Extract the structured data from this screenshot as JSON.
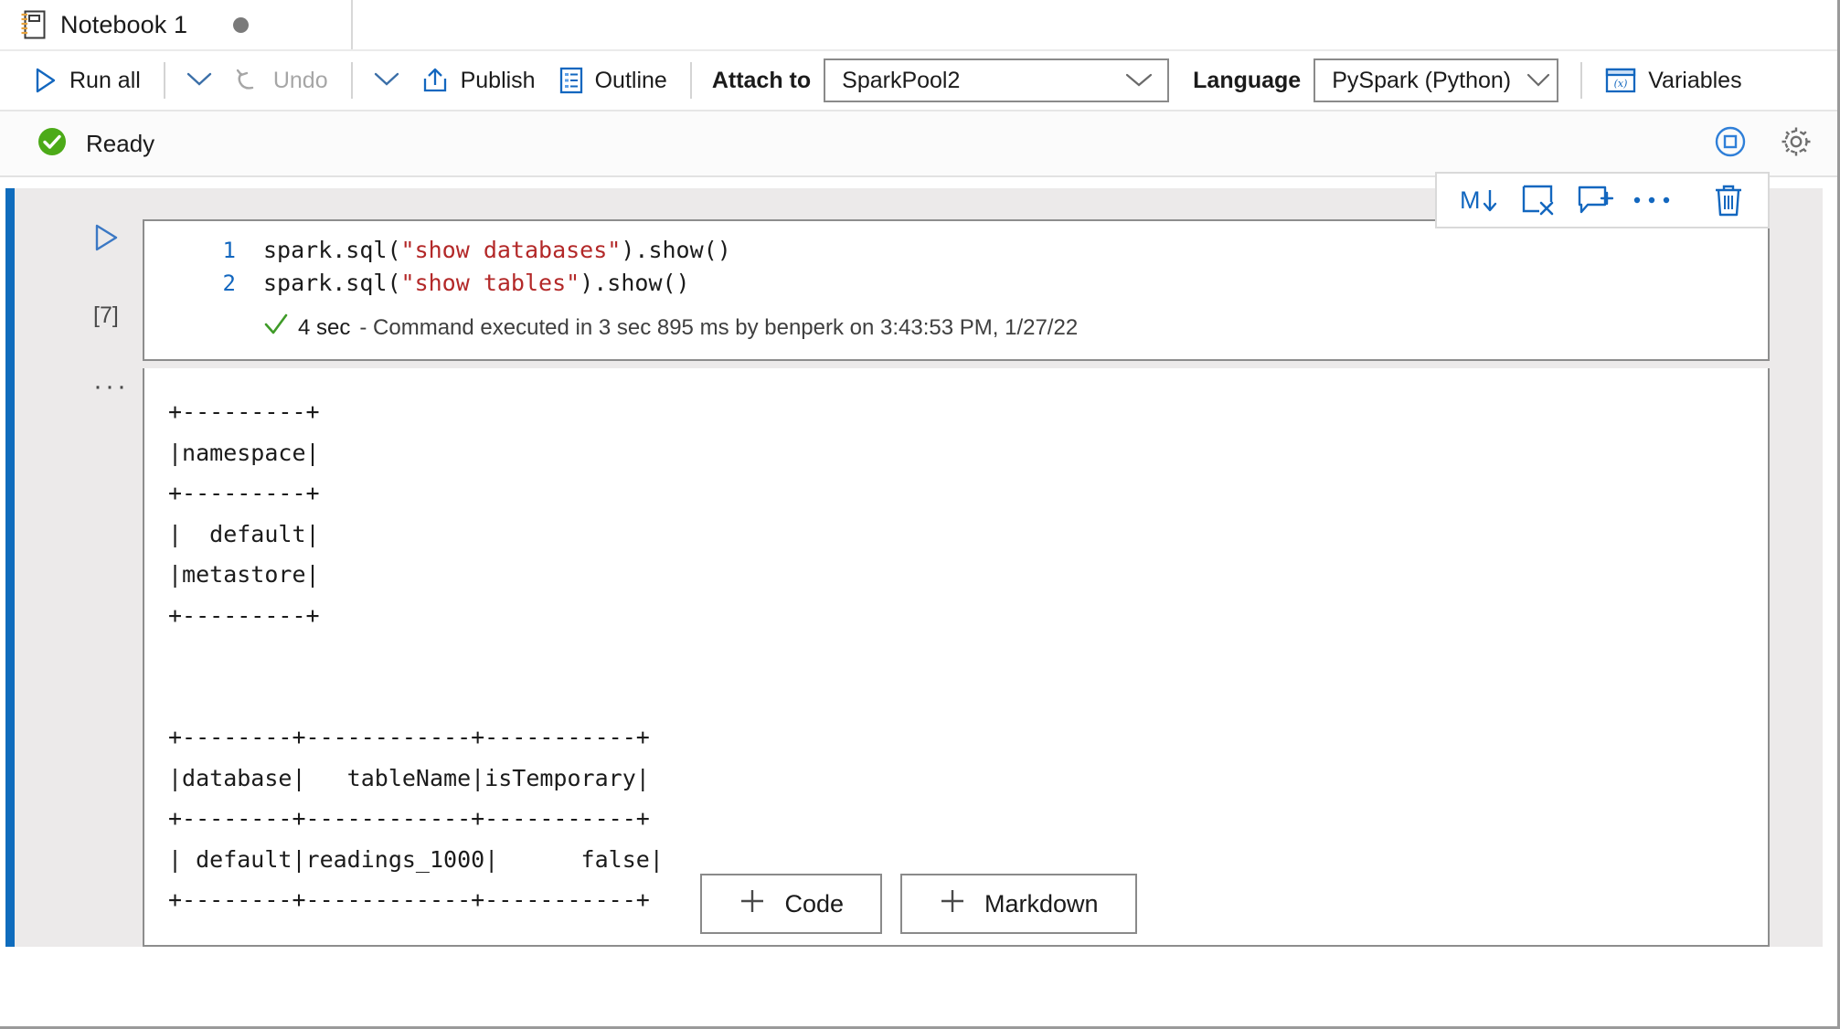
{
  "tab": {
    "title": "Notebook 1",
    "icon": "notebook-icon",
    "dirty_indicator": "unsaved-dot"
  },
  "toolbar": {
    "run_all": "Run all",
    "run_all_icon": "play-icon",
    "run_all_chevron": "chevron-down-icon",
    "undo": "Undo",
    "undo_icon": "undo-arrow-icon",
    "undo_chevron": "chevron-down-icon",
    "publish": "Publish",
    "publish_icon": "publish-upload-icon",
    "outline": "Outline",
    "outline_icon": "outline-list-icon",
    "attach_to_label": "Attach to",
    "attach_to_value": "SparkPool2",
    "attach_to_chevron": "chevron-down-icon",
    "language_label": "Language",
    "language_value": "PySpark (Python)",
    "language_chevron": "chevron-down-icon",
    "variables": "Variables",
    "variables_icon": "variables-xy-icon"
  },
  "status": {
    "text": "Ready",
    "icon": "success-check-circle-icon",
    "icon_color": "#4caa18",
    "stop_session_icon": "stop-session-icon",
    "settings_icon": "gear-icon"
  },
  "cell": {
    "accent_color": "#0f6cbd",
    "run_icon": "play-outline-icon",
    "execution_count": "[7]",
    "output_more_icon": "ellipsis-icon",
    "toolbar": {
      "convert_markdown_icon": "convert-to-markdown-icon",
      "convert_markdown_label": "M↓",
      "clear_output_icon": "clear-output-icon",
      "add_comment_icon": "add-comment-icon",
      "more_icon": "more-ellipsis-icon",
      "delete_icon": "trash-delete-icon"
    },
    "code_lines": [
      {
        "number": "1",
        "prefix": "spark.sql(",
        "string": "\"show databases\"",
        "suffix": ").show()"
      },
      {
        "number": "2",
        "prefix": "spark.sql(",
        "string": "\"show tables\"",
        "suffix": ").show()"
      }
    ],
    "exec_status": {
      "icon": "check-icon",
      "duration": "4 sec",
      "detail": "- Command executed in 3 sec 895 ms by benperk on 3:43:53 PM, 1/27/22"
    },
    "output_lines": [
      "+---------+",
      "|namespace|",
      "+---------+",
      "|  default|",
      "|metastore|",
      "+---------+",
      "",
      "",
      "+--------+------------+-----------+",
      "|database|   tableName|isTemporary|",
      "+--------+------------+-----------+",
      "| default|readings_1000|      false|",
      "+--------+------------+-----------+"
    ]
  },
  "add_cell": {
    "code_label": "Code",
    "markdown_label": "Markdown",
    "plus_icon": "plus-icon"
  }
}
